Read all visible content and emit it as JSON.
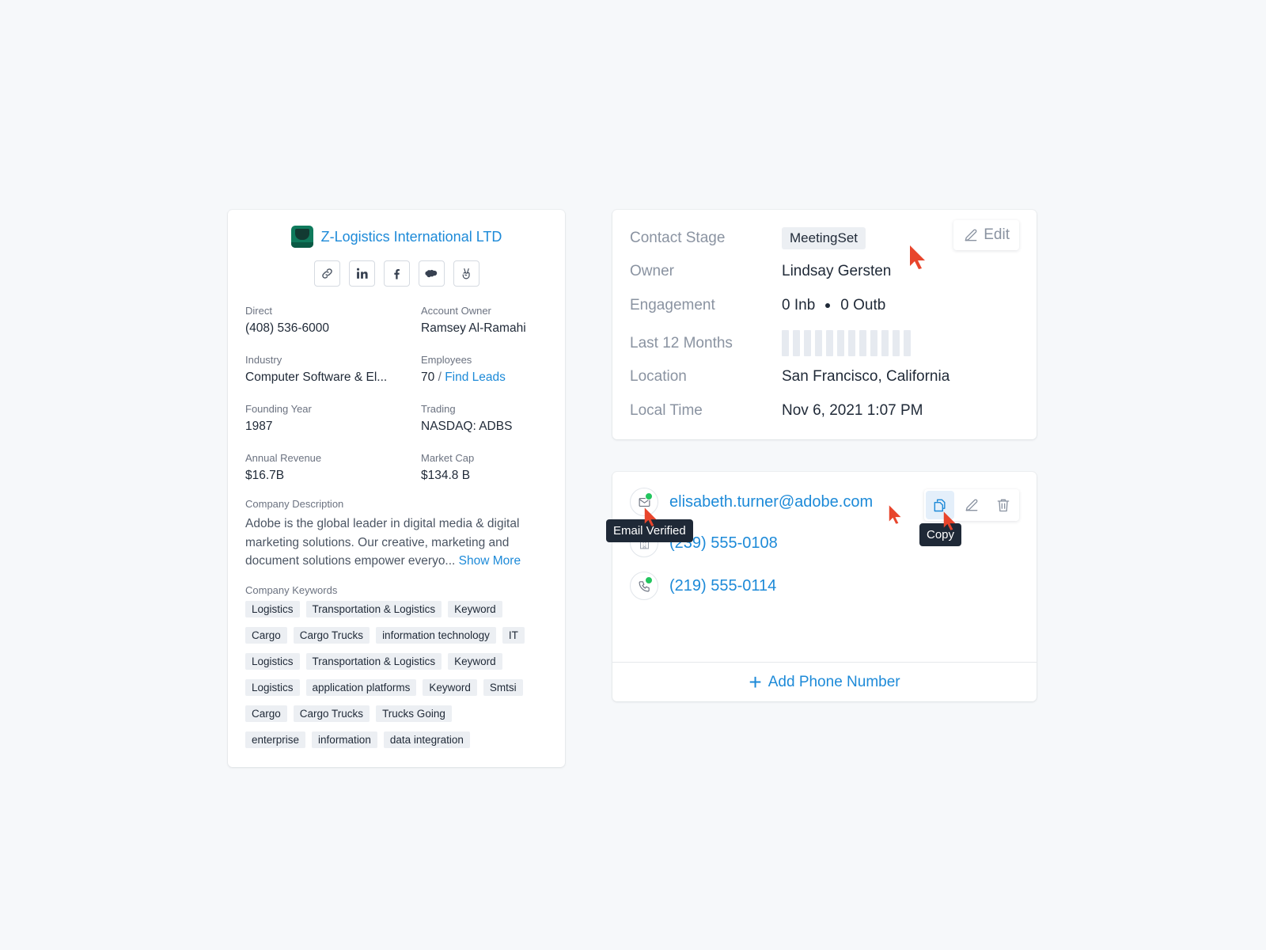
{
  "company": {
    "name": "Z-Logistics International LTD",
    "social_icons": [
      "link-icon",
      "linkedin-icon",
      "facebook-icon",
      "salesforce-icon",
      "angellist-icon"
    ],
    "fields": {
      "direct": {
        "label": "Direct",
        "value": "(408) 536-6000"
      },
      "account_owner": {
        "label": "Account Owner",
        "value": "Ramsey Al-Ramahi"
      },
      "industry": {
        "label": "Industry",
        "value": "Computer Software & El..."
      },
      "employees": {
        "label": "Employees",
        "value": "70",
        "separator": "/",
        "link": "Find Leads"
      },
      "founding_year": {
        "label": "Founding Year",
        "value": "1987"
      },
      "trading": {
        "label": "Trading",
        "value": "NASDAQ: ADBS"
      },
      "annual_revenue": {
        "label": "Annual Revenue",
        "value": "$16.7B"
      },
      "market_cap": {
        "label": "Market Cap",
        "value": "$134.8 B"
      }
    },
    "description": {
      "label": "Company Description",
      "text": "Adobe is the global leader in digital media & digital marketing solutions. Our creative, marketing and document solutions empower everyo...",
      "show_more": "Show More"
    },
    "keywords": {
      "label": "Company Keywords",
      "rows": [
        [
          "Logistics",
          "Transportation & Logistics",
          "Keyword"
        ],
        [
          "Cargo",
          "Cargo Trucks",
          "information technology",
          "IT"
        ],
        [
          "Logistics",
          "Transportation & Logistics",
          "Keyword"
        ],
        [
          "Logistics",
          "application platforms",
          "Keyword",
          "Smtsi"
        ],
        [
          "Cargo",
          "Cargo Trucks",
          "Trucks Going"
        ],
        [
          "enterprise",
          "information",
          "data integration"
        ]
      ]
    }
  },
  "contact": {
    "edit_label": "Edit",
    "stage": {
      "label": "Contact Stage",
      "value": "MeetingSet"
    },
    "owner": {
      "label": "Owner",
      "value": "Lindsay Gersten"
    },
    "engagement": {
      "label": "Engagement",
      "inbound": "0 Inb",
      "outbound": "0 Outb"
    },
    "last_12_months": {
      "label": "Last 12 Months",
      "bar_count": 12
    },
    "location": {
      "label": "Location",
      "value": "San Francisco, California"
    },
    "local_time": {
      "label": "Local Time",
      "value": "Nov 6, 2021 1:07 PM"
    }
  },
  "channels": {
    "email": "elisabeth.turner@adobe.com",
    "hq_phone": "(239) 555-0108",
    "mobile_phone": "(219) 555-0114",
    "actions": [
      "copy-icon",
      "edit-icon",
      "trash-icon"
    ],
    "tooltip_email_verified": "Email Verified",
    "tooltip_copy": "Copy",
    "add_phone_label": "Add Phone Number"
  },
  "colors": {
    "accent": "#1d8ad8",
    "verified": "#22c55e",
    "cursor": "#e8452c",
    "tooltip_bg": "#1f2937"
  }
}
